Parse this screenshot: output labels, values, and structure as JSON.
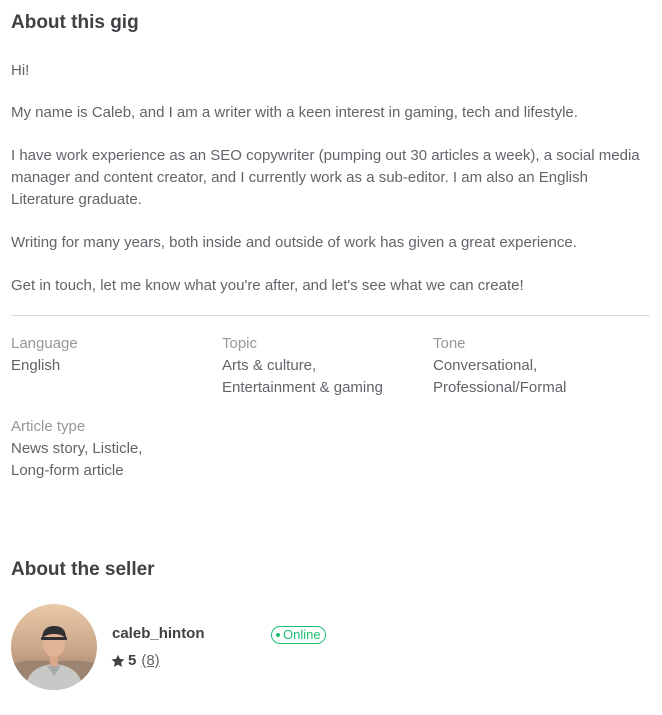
{
  "gig": {
    "title": "About this gig",
    "description": [
      "Hi!",
      "My name is Caleb, and I am a writer with a keen interest in gaming, tech and lifestyle.",
      "I have work experience as an SEO copywriter (pumping out 30 articles a week), a social media manager and content creator, and I currently work as a sub-editor. I am also an English Literature graduate.",
      "Writing for many years, both inside and outside of work has given a great experience.",
      "Get in touch, let me know what you're after, and let's see what we can create!"
    ]
  },
  "metadata": {
    "language": {
      "label": "Language",
      "lines": [
        "English"
      ]
    },
    "topic": {
      "label": "Topic",
      "lines": [
        "Arts & culture,",
        "Entertainment & gaming"
      ]
    },
    "tone": {
      "label": "Tone",
      "lines": [
        "Conversational,",
        "Professional/Formal"
      ]
    },
    "article_type": {
      "label": "Article type",
      "lines": [
        "News story, Listicle,",
        "Long-form article"
      ]
    }
  },
  "seller": {
    "section_title": "About the seller",
    "username": "caleb_hinton",
    "status": "Online",
    "rating": "5",
    "review_count": "(8)",
    "avatar_icon": "person-avatar-icon",
    "status_color": "#1dbf73"
  }
}
